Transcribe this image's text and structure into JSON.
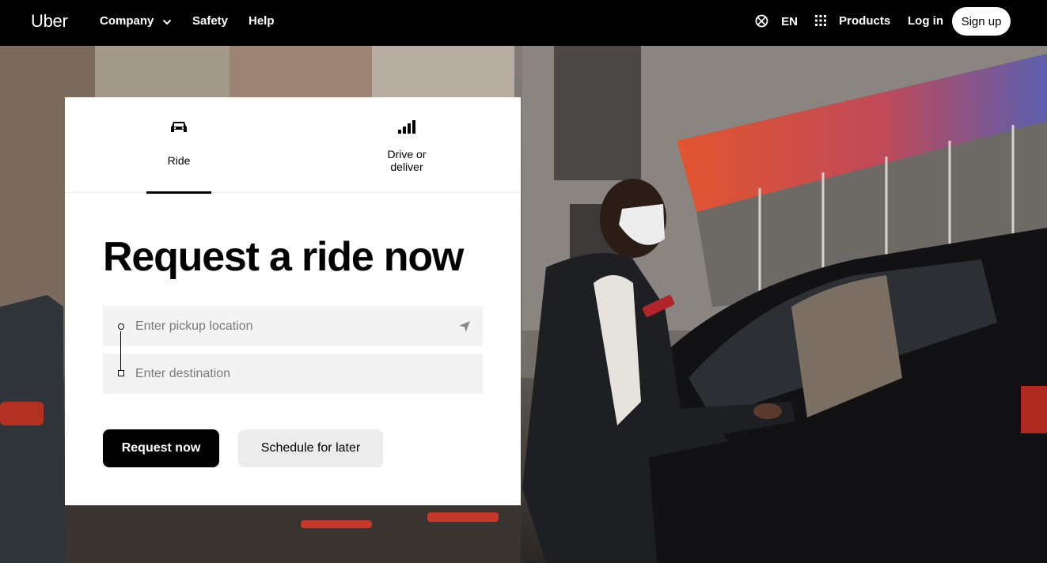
{
  "nav": {
    "logo": "Uber",
    "company": "Company",
    "safety": "Safety",
    "help": "Help",
    "language": "EN",
    "products": "Products",
    "login": "Log in",
    "signup": "Sign up"
  },
  "tabs": [
    {
      "label": "Ride",
      "icon": "car-icon",
      "active": true
    },
    {
      "label": "Drive or deliver",
      "icon": "signal-bars-icon",
      "active": false
    }
  ],
  "form": {
    "title": "Request a ride now",
    "pickup_placeholder": "Enter pickup location",
    "destination_placeholder": "Enter destination",
    "request_label": "Request now",
    "schedule_label": "Schedule for later"
  },
  "hero": {
    "description_icon": "city-street-photo"
  },
  "colors": {
    "nav_bg": "#000000",
    "primary": "#000000",
    "field_bg": "#f3f3f3",
    "secondary_button": "#ececec"
  }
}
